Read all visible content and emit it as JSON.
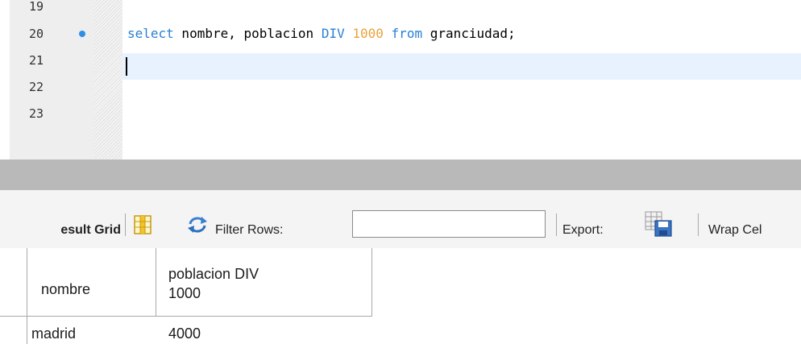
{
  "editor": {
    "lines": [
      {
        "number": "19",
        "has_breakpoint": false
      },
      {
        "number": "20",
        "has_breakpoint": true
      },
      {
        "number": "21",
        "has_breakpoint": false
      },
      {
        "number": "22",
        "has_breakpoint": false
      },
      {
        "number": "23",
        "has_breakpoint": false
      }
    ],
    "code": {
      "t1": "select",
      "t2": " nombre, poblacion ",
      "t3": "DIV",
      "t4": " ",
      "t5": "1000",
      "t6": " ",
      "t7": "from",
      "t8": " granciudad;"
    },
    "colors": {
      "keyword": "#2a7fd4",
      "number": "#e8a23a",
      "breakpoint": "#2d8fe6",
      "current_line": "#e8f2fe"
    }
  },
  "toolbar": {
    "result_grid_label": "esult Grid",
    "filter_rows_label": "Filter Rows:",
    "filter_value": "",
    "export_label": "Export:",
    "wrap_label": "Wrap Cel",
    "icons": [
      "grid-layout-icon",
      "refresh-icon",
      "export-icon"
    ]
  },
  "grid": {
    "columns": [
      "nombre",
      "poblacion DIV\n1000"
    ],
    "rows": [
      [
        "madrid",
        "4000"
      ]
    ]
  }
}
